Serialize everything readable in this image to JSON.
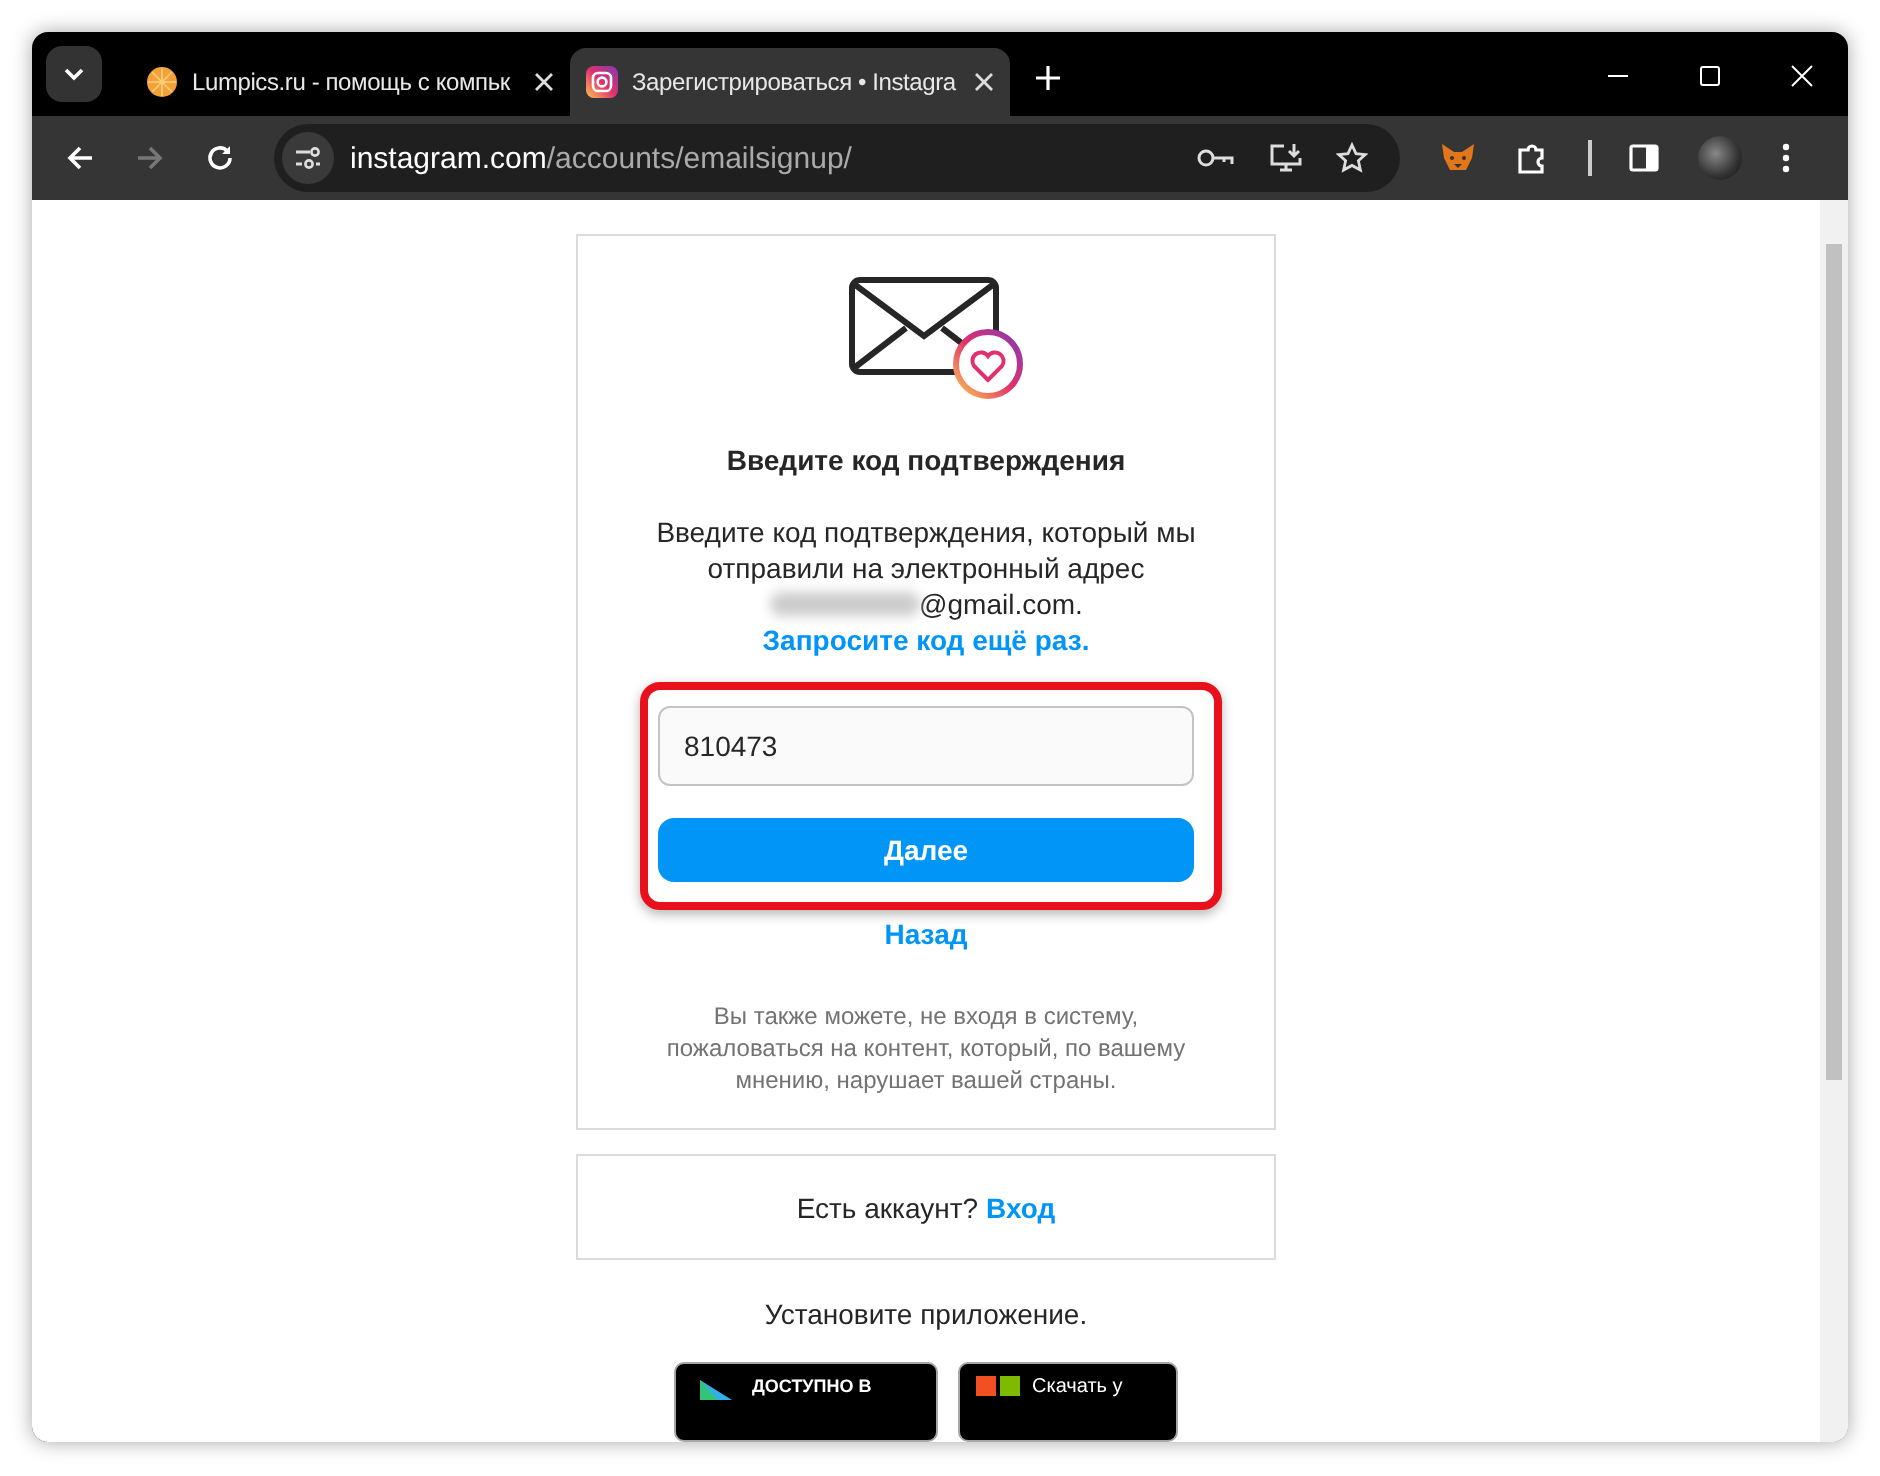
{
  "tabs": [
    {
      "title": "Lumpics.ru - помощь с компьк",
      "selected": false,
      "kind": "lumpics"
    },
    {
      "title": "Зарегистрироваться • Instagra",
      "selected": true,
      "kind": "instagram"
    }
  ],
  "address": {
    "host": "instagram.com",
    "path": "/accounts/emailsignup/"
  },
  "heading": "Введите код подтверждения",
  "message": {
    "text": "Введите код подтверждения, который мы отправили на электронный адрес",
    "email": "@gmail.com.",
    "link": "Запросите код ещё раз."
  },
  "code_field": {
    "value": "810473"
  },
  "next_button": "Далее",
  "back_link": "Назад",
  "note": "Вы также можете, не входя в систему, пожаловаться на контент, который, по вашему мнению, нарушает вашей страны.",
  "login": {
    "text": "Есть аккаунт?",
    "link": "Вход"
  },
  "install": "Установите приложение.",
  "badges": [
    {
      "kind": "google",
      "text": "ДОСТУПНО В"
    },
    {
      "kind": "microsoft",
      "text": "Скачать у"
    }
  ]
}
